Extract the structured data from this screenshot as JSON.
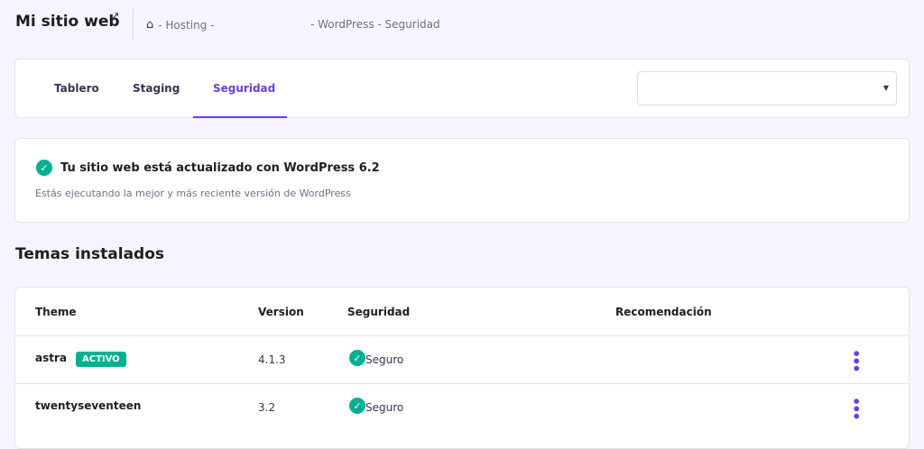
{
  "header": {
    "title": "Mi sitio web",
    "breadcrumb": [
      "- Hosting -",
      "- WordPress",
      "- Seguridad"
    ]
  },
  "tabs": [
    {
      "label": "Tablero"
    },
    {
      "label": "Staging"
    },
    {
      "label": "Seguridad",
      "active": true
    }
  ],
  "select": {
    "value": ""
  },
  "notice": {
    "title": "Tu sitio web está actualizado con WordPress 6.2",
    "text": "Estás ejecutando la mejor y más reciente versión de WordPress"
  },
  "themes": {
    "heading": "Temas instalados",
    "columns": [
      "Theme",
      "Version",
      "Seguridad",
      "Recomendación"
    ],
    "rows": [
      {
        "name": "astra",
        "badge": "ACTIVO",
        "version": "4.1.3",
        "security": "Seguro"
      },
      {
        "name": "twentyseventeen",
        "version": "3.2",
        "security": "Seguro"
      }
    ]
  },
  "colors": {
    "accent": "#673de6",
    "success": "#00b090"
  }
}
